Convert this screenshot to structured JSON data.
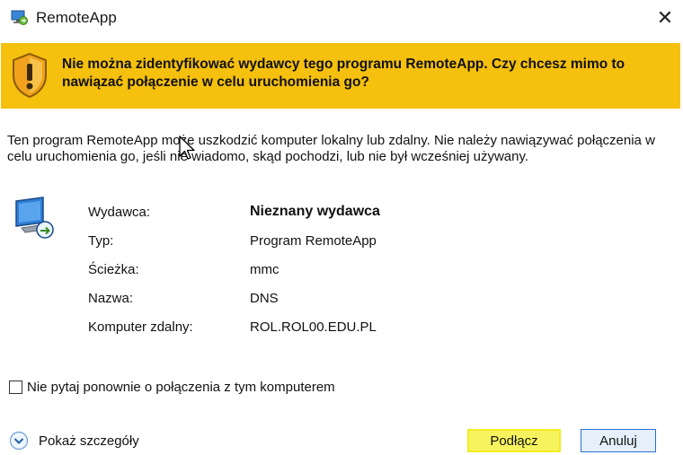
{
  "window": {
    "title": "RemoteApp",
    "close_glyph": "✕"
  },
  "banner": {
    "text": "Nie można zidentyfikować wydawcy tego programu RemoteApp. Czy chcesz mimo to nawiązać połączenie w celu uruchomienia go?",
    "background_color": "#f5c00e",
    "icon": "warning-shield-icon"
  },
  "warning": {
    "text": "Ten program RemoteApp może uszkodzić komputer lokalny lub zdalny. Nie należy nawiązywać połączenia w celu uruchomienia go, jeśli nie wiadomo, skąd pochodzi, lub nie był wcześniej używany."
  },
  "details": {
    "icon": "remote-computer-icon",
    "rows": [
      {
        "label": "Wydawca:",
        "value": "Nieznany wydawca"
      },
      {
        "label": "Typ:",
        "value": "Program RemoteApp"
      },
      {
        "label": "Ścieżka:",
        "value": "mmc"
      },
      {
        "label": "Nazwa:",
        "value": "DNS"
      },
      {
        "label": "Komputer zdalny:",
        "value": "ROL.ROL00.EDU.PL"
      }
    ]
  },
  "dont_ask": {
    "label": "Nie pytaj ponownie o połączenia z tym komputerem",
    "checked": false
  },
  "show_details": {
    "label": "Pokaż szczegóły",
    "icon": "chevron-down-circle-icon"
  },
  "buttons": {
    "connect": "Podłącz",
    "cancel": "Anuluj",
    "connect_highlight_color": "#f7f35e"
  }
}
